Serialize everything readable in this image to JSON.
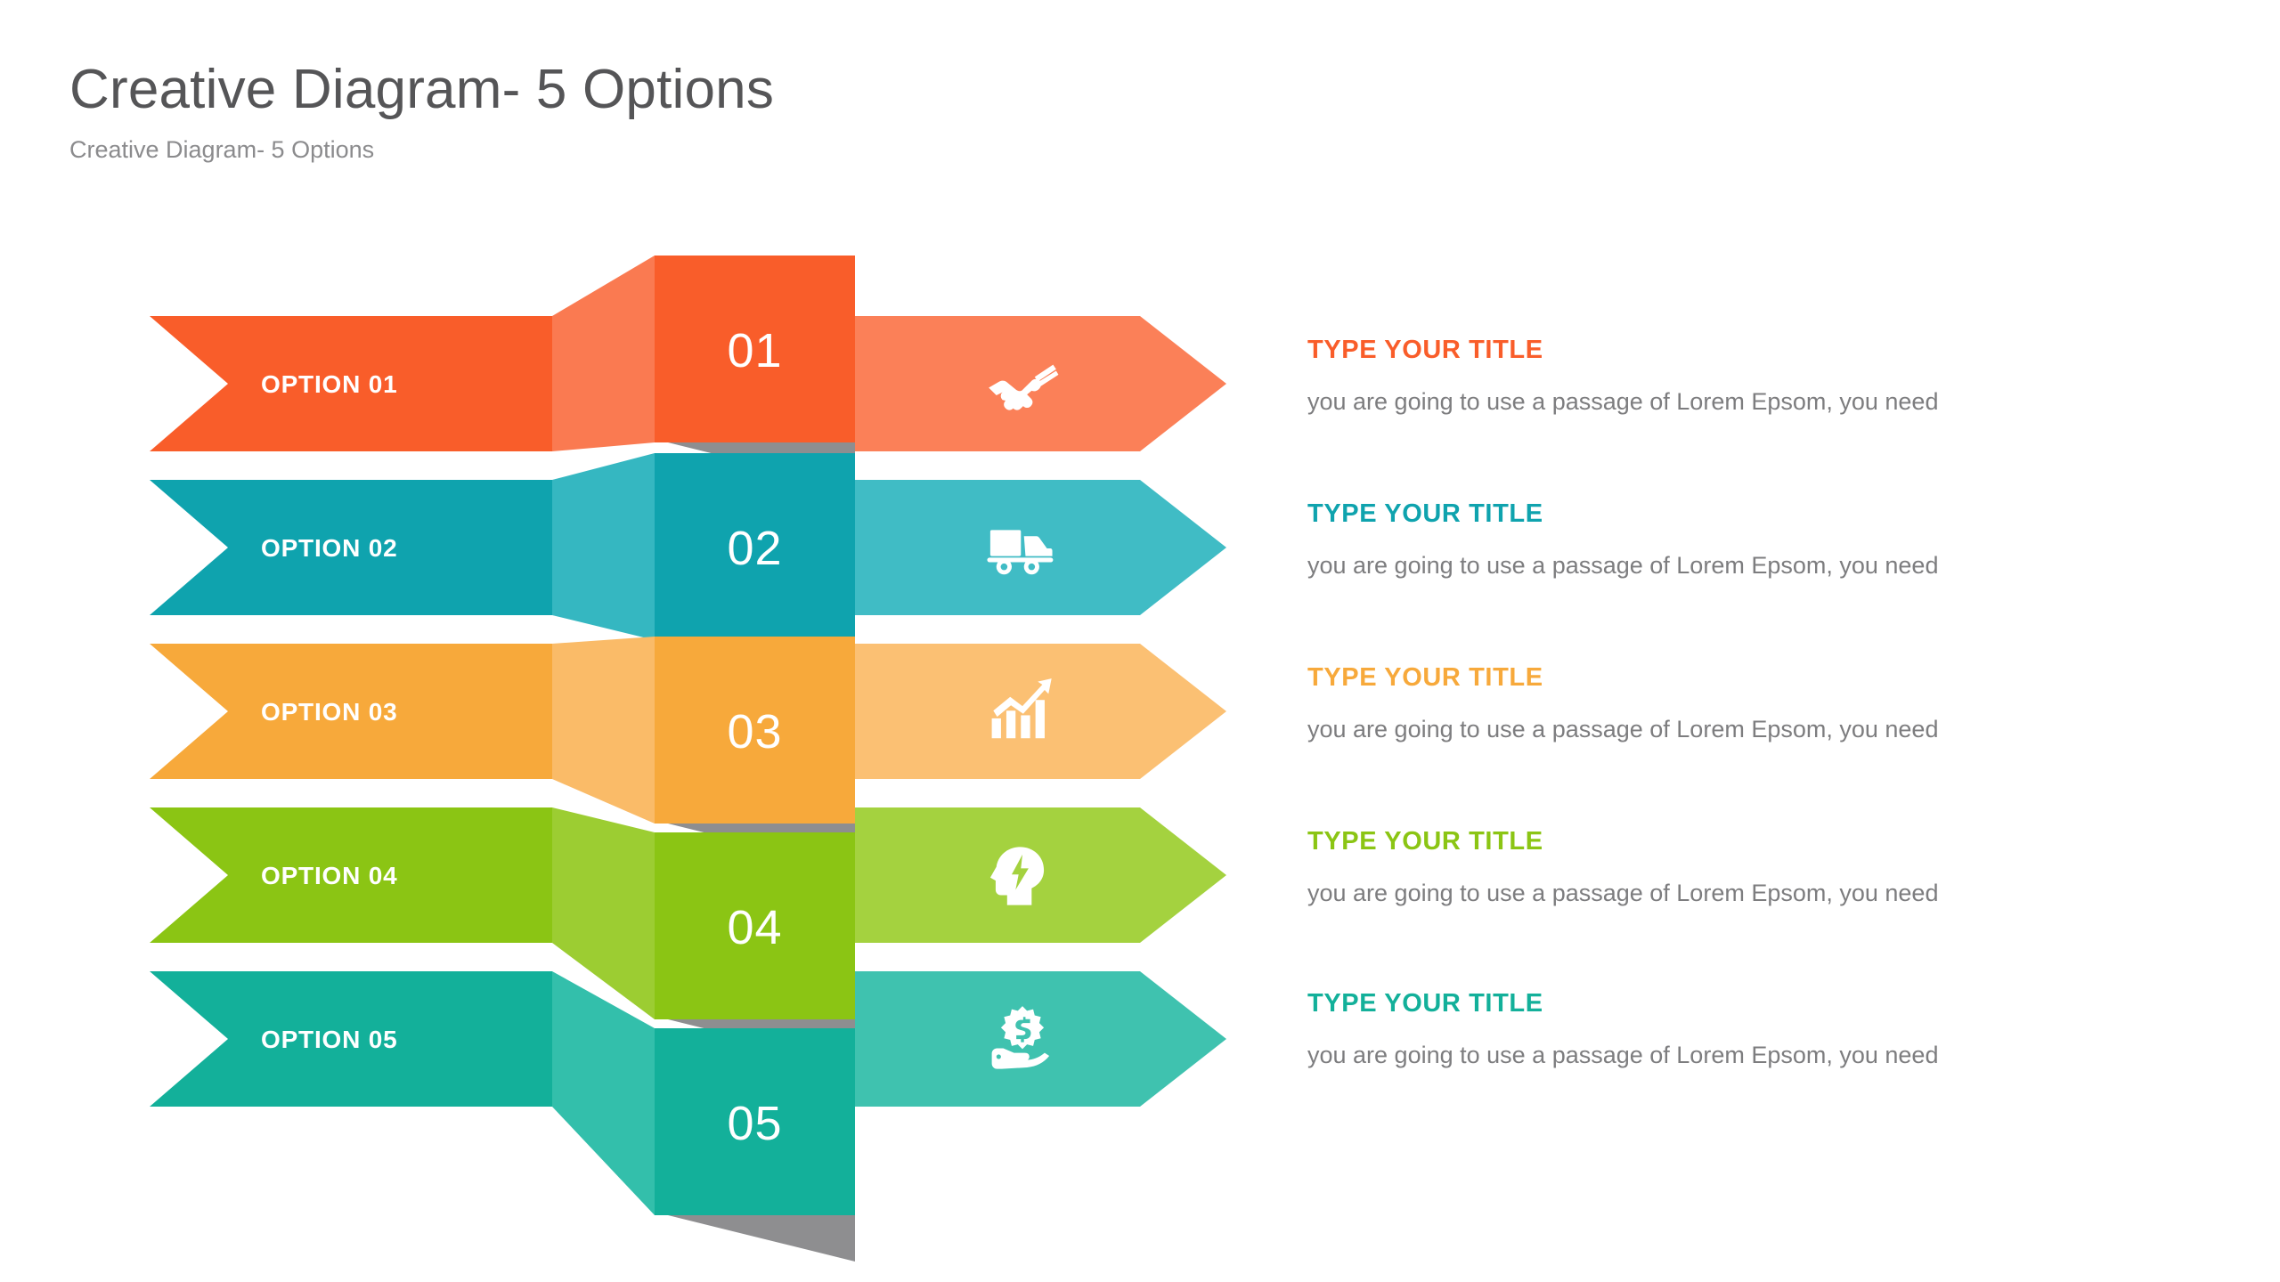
{
  "header": {
    "title": "Creative Diagram- 5 Options",
    "subtitle": "Creative Diagram- 5 Options"
  },
  "palette": {
    "background": "#ffffff",
    "title_text": "#555557",
    "subtitle_text": "#8b8b8d",
    "body_text": "#7d7d7f",
    "shadow": "#757578"
  },
  "rows": [
    {
      "option_label": "OPTION 01",
      "number": "01",
      "icon": "handshake-icon",
      "title": "TYPE YOUR TITLE",
      "body": "you are going to use a passage of Lorem Epsom, you need",
      "color_main": "#f95d2a",
      "color_light": "#fb8058",
      "color_fold": "#fa7a51"
    },
    {
      "option_label": "OPTION 02",
      "number": "02",
      "icon": "delivery-truck-icon",
      "title": "TYPE YOUR TITLE",
      "body": "you are going to use a passage of Lorem Epsom, you need",
      "color_main": "#0fa3ae",
      "color_light": "#40bcc5",
      "color_fold": "#35b7c1"
    },
    {
      "option_label": "OPTION 03",
      "number": "03",
      "icon": "growth-chart-icon",
      "title": "TYPE YOUR TITLE",
      "body": "you are going to use a passage of Lorem Epsom, you need",
      "color_main": "#f7a93b",
      "color_light": "#fbc073",
      "color_fold": "#fabb68"
    },
    {
      "option_label": "OPTION 04",
      "number": "04",
      "icon": "brain-idea-icon",
      "title": "TYPE YOUR TITLE",
      "body": "you are going to use a passage of Lorem Epsom, you need",
      "color_main": "#8bc514",
      "color_light": "#a4d23f",
      "color_fold": "#9ccd32"
    },
    {
      "option_label": "OPTION 05",
      "number": "05",
      "icon": "money-hand-icon",
      "title": "TYPE YOUR TITLE",
      "body": "you are going to use a passage of Lorem Epsom, you need",
      "color_main": "#13b09a",
      "color_light": "#3fc2af",
      "color_fold": "#33bfab"
    }
  ]
}
